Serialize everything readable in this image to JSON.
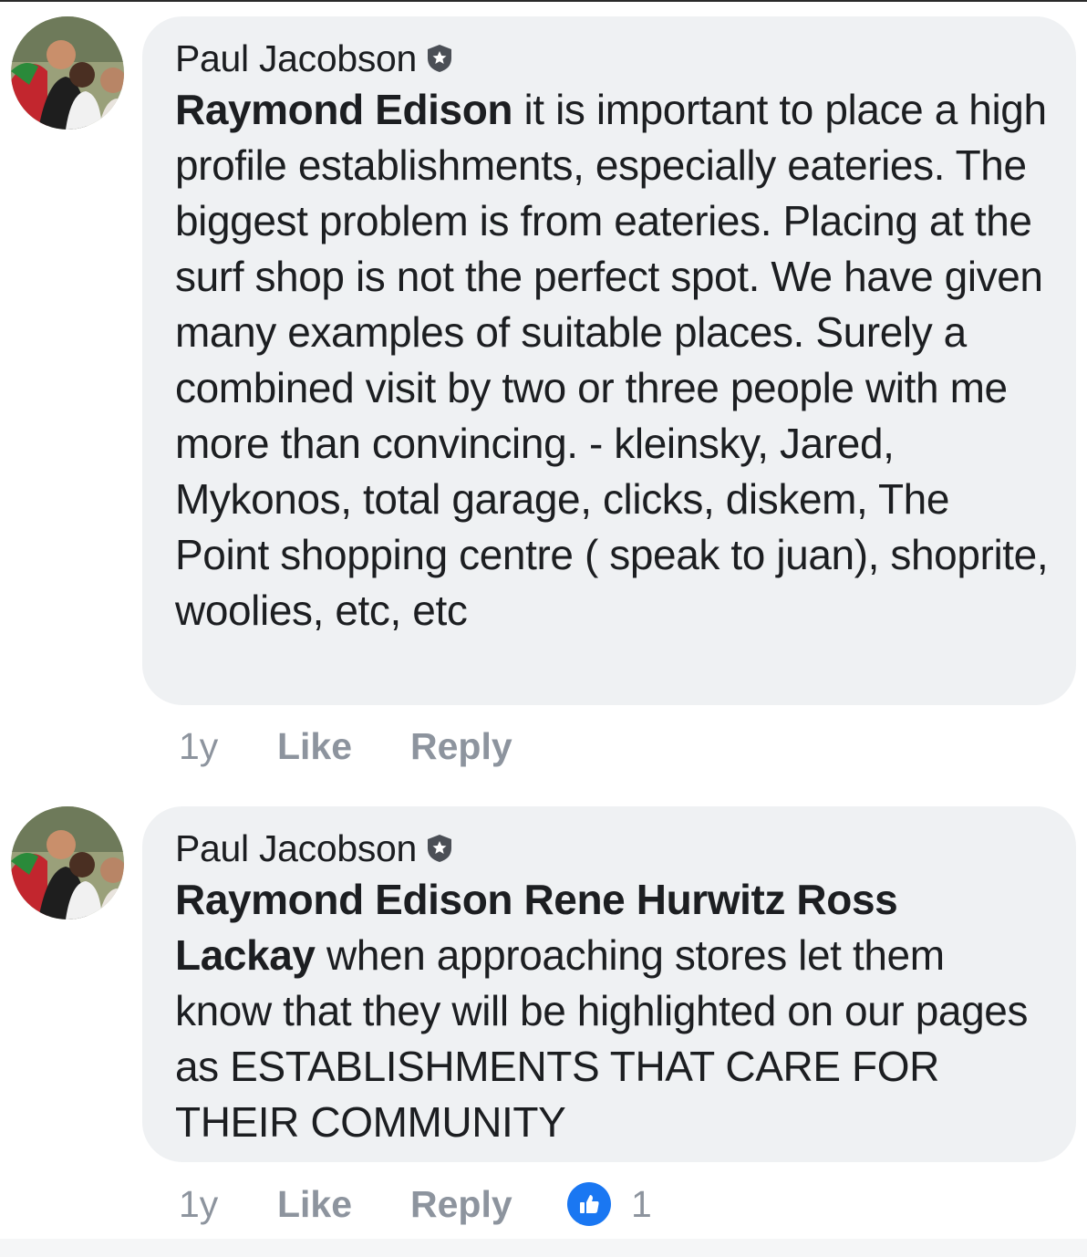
{
  "comments": [
    {
      "author": "Paul Jacobson",
      "badge_icon": "top-fan-shield-icon",
      "mentions": "Raymond Edison",
      "text": " it is important to place a high profile establishments, especially eateries. The biggest problem is from eateries. Placing at the surf shop is not the perfect spot. We have given many examples of suitable places. Surely a combined visit by two or three people with me more than convincing. - kleinsky, Jared, Mykonos, total garage, clicks, diskem, The Point shopping centre ( speak to juan), shoprite, woolies, etc, etc",
      "time": "1y",
      "like_label": "Like",
      "reply_label": "Reply"
    },
    {
      "author": "Paul Jacobson",
      "badge_icon": "top-fan-shield-icon",
      "mentions": "Raymond Edison Rene Hurwitz Ross Lackay",
      "text": " when approaching stores let them know that they will be highlighted on our pages as ESTABLISHMENTS THAT CARE FOR THEIR COMMUNITY",
      "time": "1y",
      "like_label": "Like",
      "reply_label": "Reply",
      "reaction_icon": "like-thumb-icon",
      "reaction_count": "1"
    }
  ],
  "colors": {
    "bubble": "#eff1f3",
    "meta_text": "#8d949e",
    "like_blue": "#1a77f2"
  }
}
